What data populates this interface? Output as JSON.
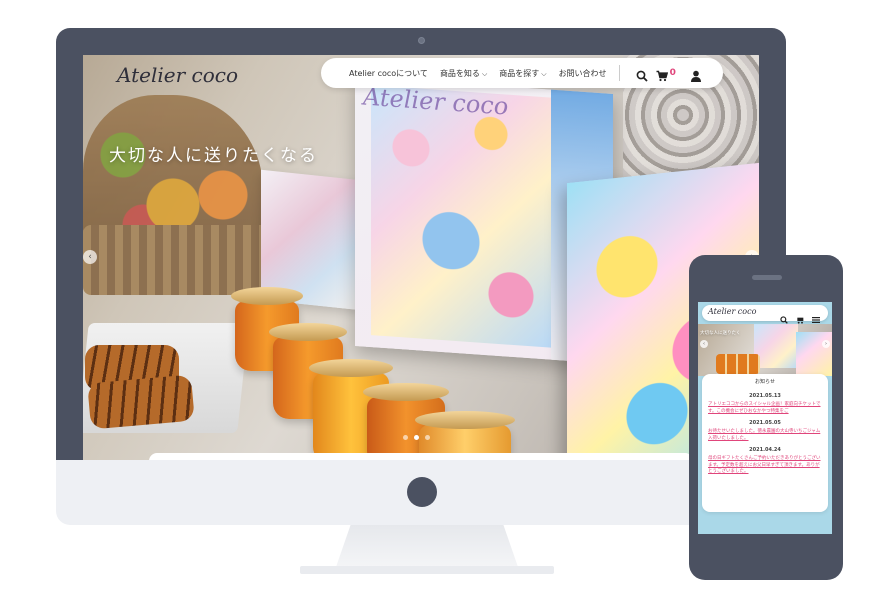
{
  "desktop": {
    "site_logo": "Atelier coco",
    "hero_copy": "大切な人に送りたくなる",
    "nav": {
      "items": [
        {
          "label": "Atelier cocoについて",
          "has_dropdown": false
        },
        {
          "label": "商品を知る",
          "has_dropdown": true
        },
        {
          "label": "商品を探す",
          "has_dropdown": true
        },
        {
          "label": "お問い合わせ",
          "has_dropdown": false
        }
      ],
      "cart_count": "0",
      "icons": [
        "search-icon",
        "cart-icon",
        "user-icon"
      ]
    },
    "slider": {
      "dot_count": 3,
      "active_index": 1
    }
  },
  "mobile": {
    "site_logo": "Atelier coco",
    "hero_copy": "大切な人に送りたく",
    "icons": [
      "search-icon",
      "cart-icon",
      "menu-icon"
    ],
    "news": {
      "title": "お知らせ",
      "items": [
        {
          "date": "2021.05.13",
          "text": "アトリエココからのスイシャル企画！家庭向チケットです。この機会にぜひおなかやつ特集をご"
        },
        {
          "date": "2021.05.05",
          "text": "お待たせいたしました。徳永農園の大山寺いちごジャム入荷いたしました。"
        },
        {
          "date": "2021.04.24",
          "text": "母の日ギフトたくさんご予約いただきありがとうございます。予定数を超えにお父日早すぎて頂きます。ありがとうございました。"
        }
      ]
    }
  },
  "colors": {
    "device_frame": "#4b5161",
    "monitor_chin": "#eef0f4",
    "accent": "#e0457b",
    "link": "#e0457b"
  }
}
